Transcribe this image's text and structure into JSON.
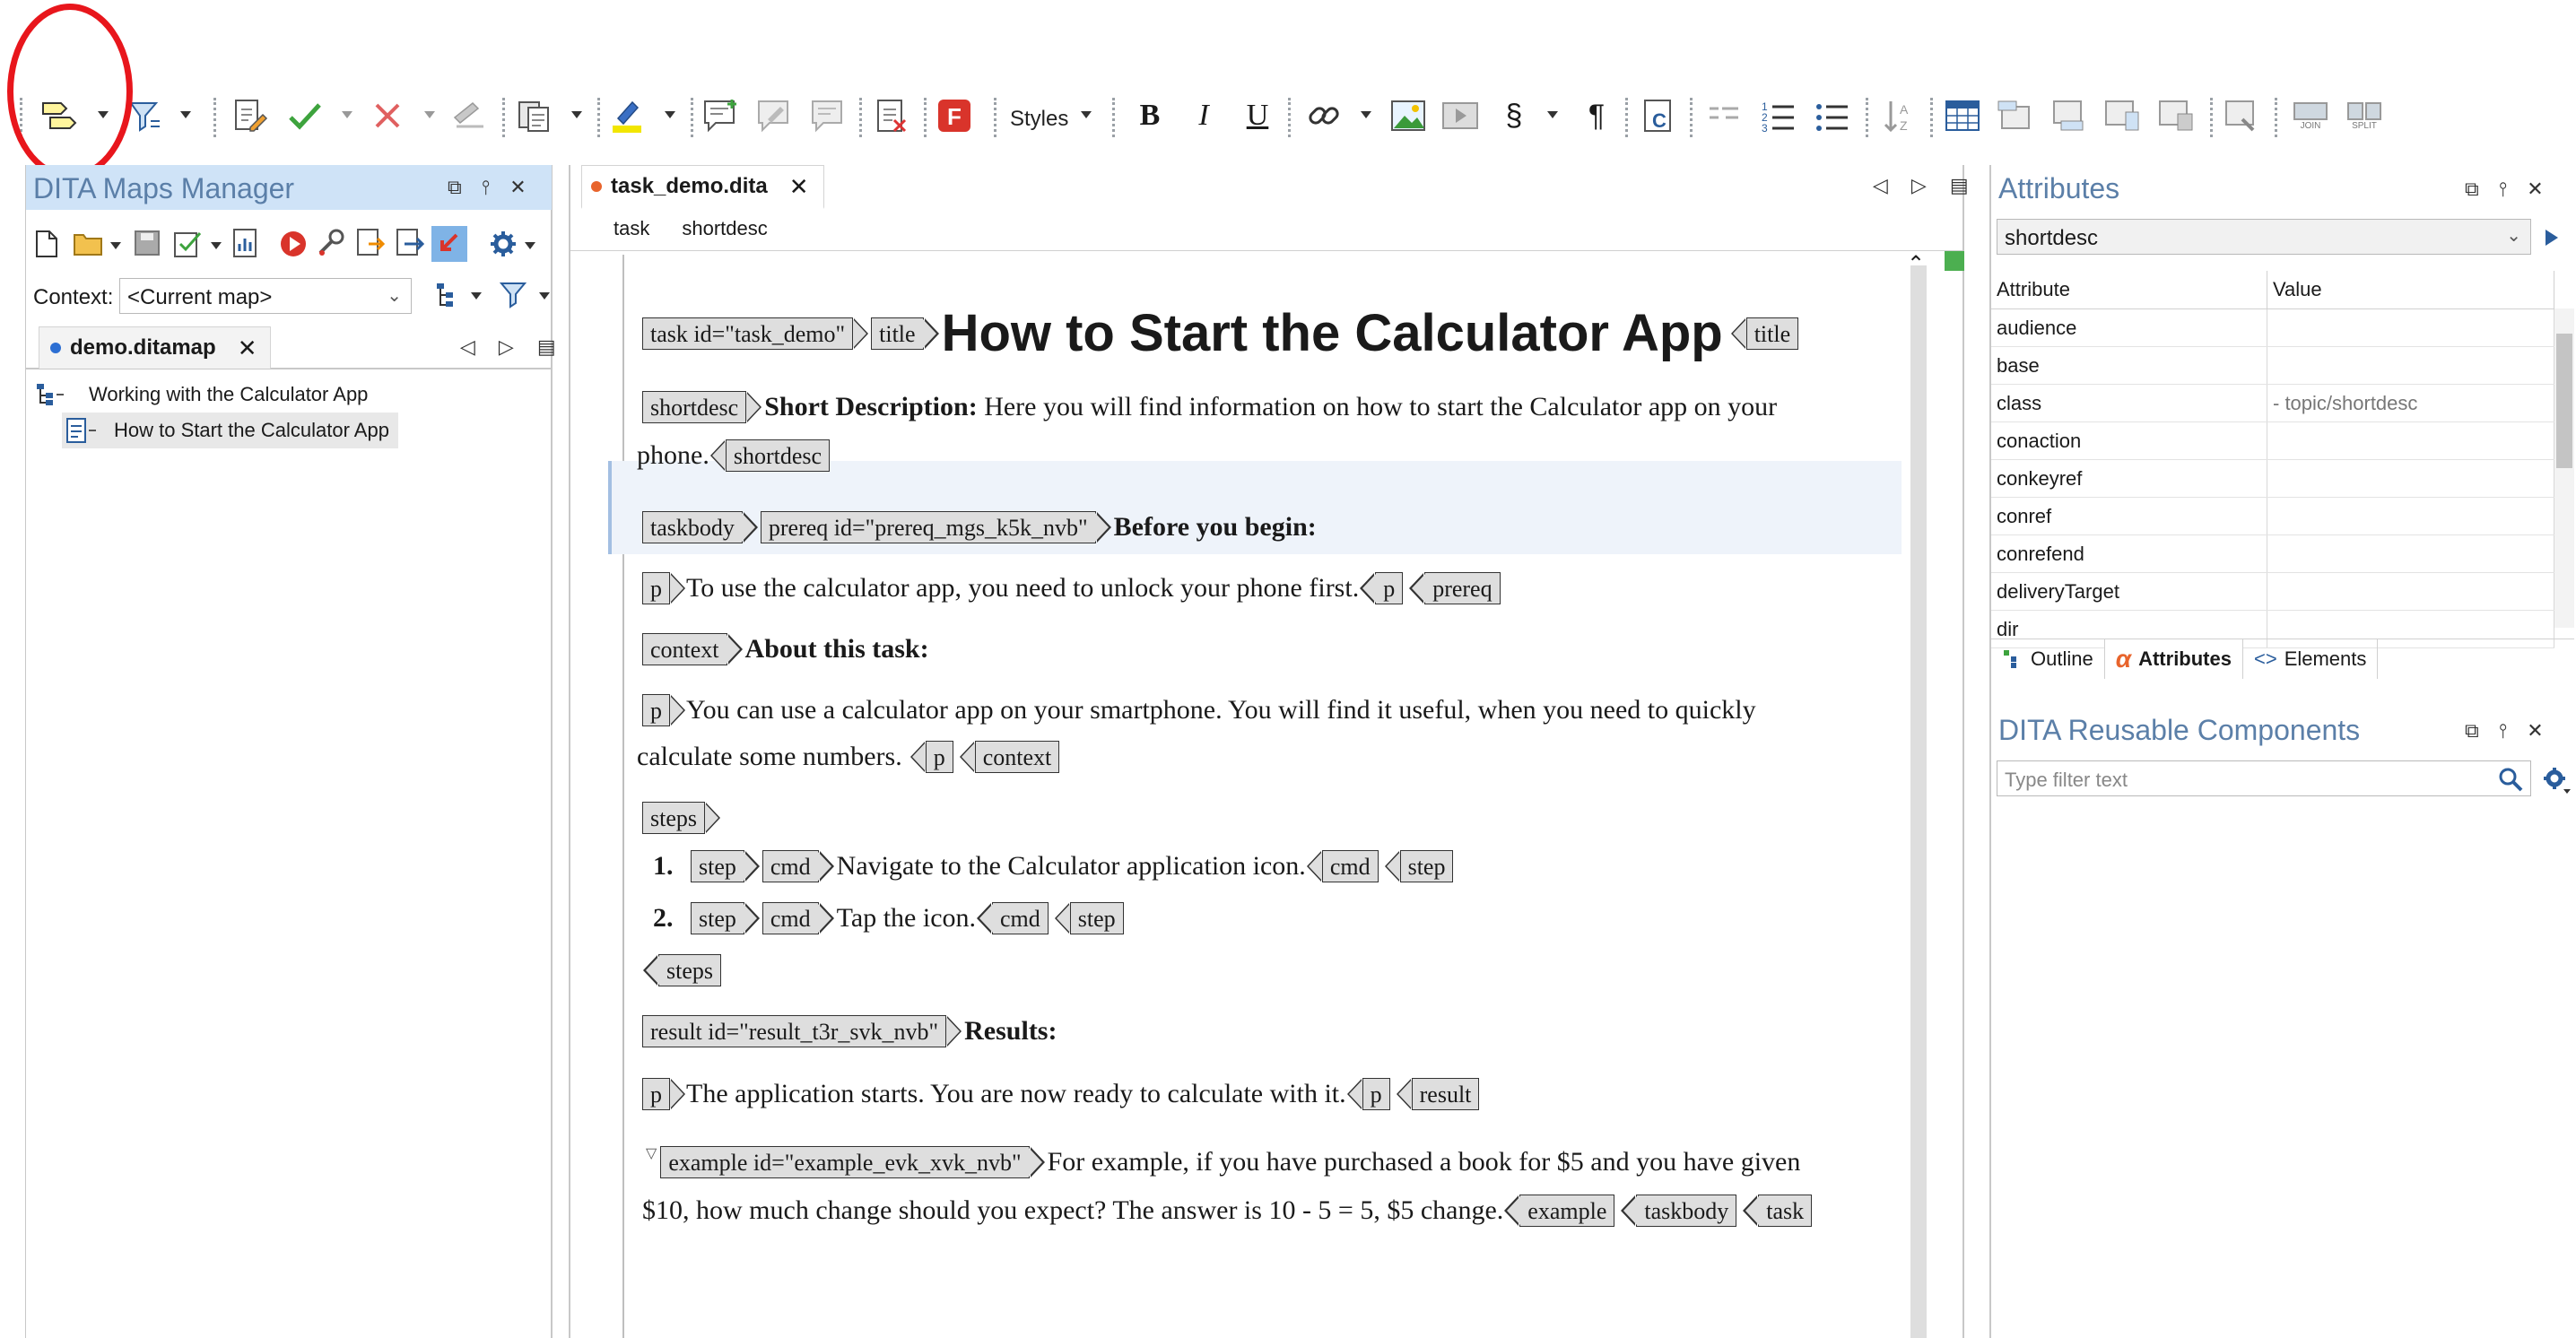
{
  "toolbar": {
    "styles_label": "Styles",
    "bold": "B",
    "italic": "I",
    "underline": "U",
    "section": "§",
    "pilcrow": "¶",
    "join": "JOIN",
    "split": "SPLIT"
  },
  "maps_manager": {
    "title": "DITA Maps Manager",
    "context_label": "Context:",
    "context_value": "<Current map>",
    "tab": "demo.ditamap",
    "tree": [
      {
        "label": "Working with the Calculator App"
      },
      {
        "label": "How to Start the Calculator App"
      }
    ]
  },
  "editor": {
    "tab": "task_demo.dita",
    "breadcrumb": [
      "task",
      "shortdesc"
    ],
    "doc": {
      "task_tag": "task id=\"task_demo\"",
      "title_tag": "title",
      "title_text": "How to Start the Calculator App",
      "shortdesc_tag": "shortdesc",
      "shortdesc_bold": "Short Description:",
      "shortdesc_text1": "Here you will find information on how to start the Calculator app on your",
      "shortdesc_text2": "phone.",
      "taskbody_tag": "taskbody",
      "prereq_tag": "prereq id=\"prereq_mgs_k5k_nvb\"",
      "prereq_heading": "Before you begin:",
      "p_tag": "p",
      "prereq_text": "To use the calculator app, you need to unlock your phone first.",
      "prereq_close": "prereq",
      "context_tag": "context",
      "context_heading": "About this task:",
      "context_text1": "You can use a calculator app on your smartphone. You will find it useful, when you need to quickly",
      "context_text2": "calculate some numbers.",
      "steps_tag": "steps",
      "step_tag": "step",
      "cmd_tag": "cmd",
      "step1_num": "1.",
      "step1_text": "Navigate to the Calculator application icon.",
      "step2_num": "2.",
      "step2_text": "Tap the icon.",
      "result_tag": "result id=\"result_t3r_svk_nvb\"",
      "result_heading": "Results:",
      "result_text": "The application starts. You are now ready to calculate with it.",
      "result_close": "result",
      "example_tag": "example id=\"example_evk_xvk_nvb\"",
      "example_text1": "For example, if you have purchased a book for $5 and you have given",
      "example_text2": "$10, how much change should you expect? The answer is 10 - 5 = 5, $5 change.",
      "example_close": "example",
      "taskbody_close": "taskbody",
      "task_close": "task"
    }
  },
  "attributes": {
    "title": "Attributes",
    "element": "shortdesc",
    "col_attribute": "Attribute",
    "col_value": "Value",
    "rows": [
      {
        "name": "audience",
        "value": ""
      },
      {
        "name": "base",
        "value": ""
      },
      {
        "name": "class",
        "value": "- topic/shortdesc"
      },
      {
        "name": "conaction",
        "value": ""
      },
      {
        "name": "conkeyref",
        "value": ""
      },
      {
        "name": "conref",
        "value": ""
      },
      {
        "name": "conrefend",
        "value": ""
      },
      {
        "name": "deliveryTarget",
        "value": ""
      },
      {
        "name": "dir",
        "value": ""
      }
    ],
    "tabs": [
      "Outline",
      "Attributes",
      "Elements"
    ]
  },
  "reusable": {
    "title": "DITA Reusable Components",
    "filter_placeholder": "Type filter text"
  },
  "colors": {
    "accent": "#2d6fd3",
    "panel_title": "#5b7fa8",
    "highlight_circle": "#e8161c",
    "tag_fill": "#dedede"
  }
}
